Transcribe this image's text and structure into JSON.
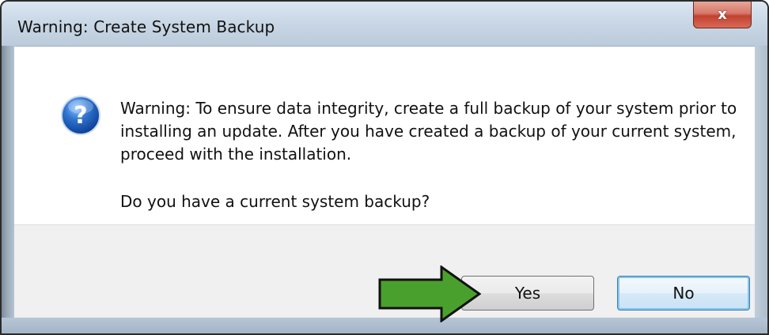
{
  "window": {
    "title": "Warning: Create System Backup"
  },
  "titlebar": {
    "close_glyph": "x"
  },
  "dialog": {
    "icon": "question-icon",
    "message": "Warning: To ensure data integrity, create a full backup of your system prior to installing an update. After you have created a backup of your current system, proceed with the installation.",
    "question": "Do you have a current system backup?"
  },
  "buttons": {
    "yes": "Yes",
    "no": "No"
  },
  "annotation": {
    "icon": "arrow-right-icon",
    "color": "#4aa02c"
  }
}
